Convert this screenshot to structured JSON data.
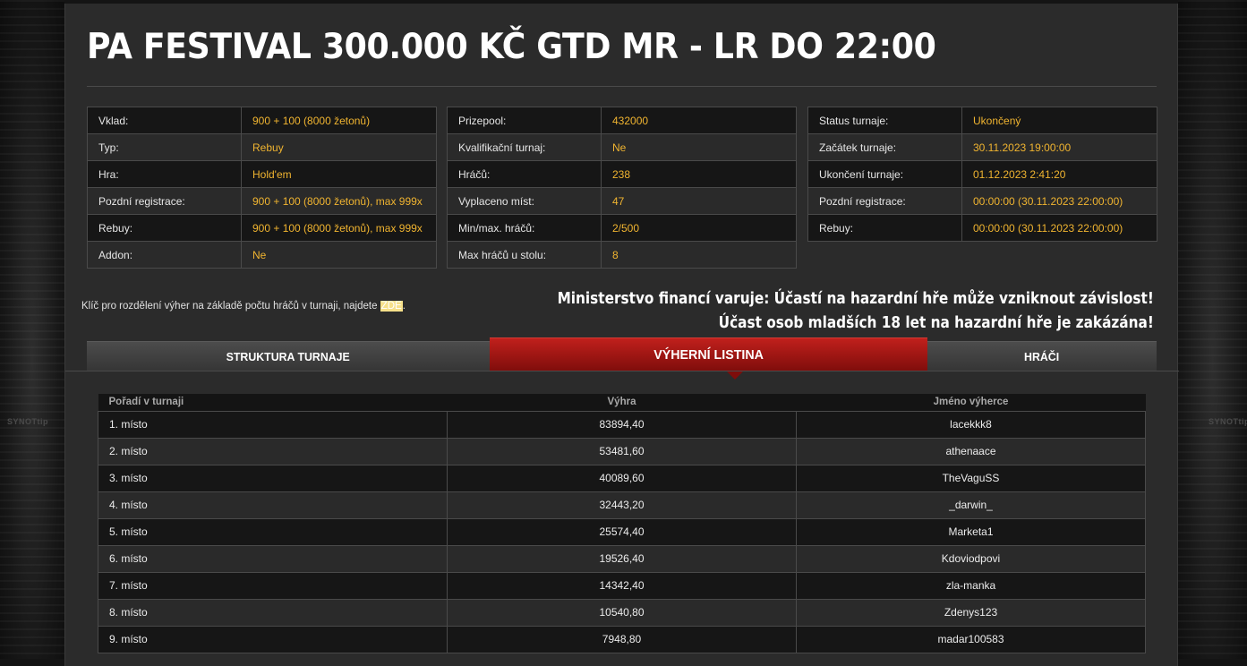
{
  "title": "PA FESTIVAL 300.000 KČ GTD MR - LR DO 22:00",
  "background_brand": "SYNOTtip",
  "info_left": [
    {
      "label": "Vklad:",
      "value": "900 + 100 (8000 žetonů)"
    },
    {
      "label": "Typ:",
      "value": "Rebuy"
    },
    {
      "label": "Hra:",
      "value": "Hold'em"
    },
    {
      "label": "Pozdní registrace:",
      "value": "900 + 100 (8000 žetonů), max 999x"
    },
    {
      "label": "Rebuy:",
      "value": "900 + 100 (8000 žetonů), max 999x"
    },
    {
      "label": "Addon:",
      "value": "Ne"
    }
  ],
  "info_middle": [
    {
      "label": "Prizepool:",
      "value": "432000"
    },
    {
      "label": "Kvalifikační turnaj:",
      "value": "Ne"
    },
    {
      "label": "Hráčů:",
      "value": "238"
    },
    {
      "label": "Vyplaceno míst:",
      "value": "47"
    },
    {
      "label": "Min/max. hráčů:",
      "value": "2/500"
    },
    {
      "label": "Max hráčů u stolu:",
      "value": "8"
    }
  ],
  "info_right": [
    {
      "label": "Status turnaje:",
      "value": "Ukončený"
    },
    {
      "label": "Začátek turnaje:",
      "value": "30.11.2023 19:00:00"
    },
    {
      "label": "Ukončení turnaje:",
      "value": "01.12.2023 2:41:20"
    },
    {
      "label": "Pozdní registrace:",
      "value": "00:00:00 (30.11.2023 22:00:00)"
    },
    {
      "label": "Rebuy:",
      "value": "00:00:00 (30.11.2023 22:00:00)"
    }
  ],
  "key_note": {
    "text": "Klíč pro rozdělení výher na základě počtu hráčů v turnaji, najdete ",
    "link": "ZDE",
    "suffix": "."
  },
  "warning": {
    "line1": "Ministerstvo financí varuje: Účastí na hazardní hře může vzniknout závislost!",
    "line2": "Účast osob mladších 18 let na hazardní hře je zakázána!"
  },
  "tabs": [
    {
      "label": "STRUKTURA TURNAJE",
      "active": false
    },
    {
      "label": "VÝHERNÍ LISTINA",
      "active": true
    },
    {
      "label": "HRÁČI",
      "active": false
    }
  ],
  "colors": {
    "accent_red": "#b5191a",
    "value_gold": "#f0b430",
    "panel": "#2b2b2b"
  },
  "results": {
    "headers": [
      "Pořadí v turnaji",
      "Výhra",
      "Jméno výherce"
    ],
    "rows": [
      [
        "1. místo",
        "83894,40",
        "lacekkk8"
      ],
      [
        "2. místo",
        "53481,60",
        "athenaace"
      ],
      [
        "3. místo",
        "40089,60",
        "TheVaguSS"
      ],
      [
        "4. místo",
        "32443,20",
        "_darwin_"
      ],
      [
        "5. místo",
        "25574,40",
        "Marketa1"
      ],
      [
        "6. místo",
        "19526,40",
        "Kdoviodpovi"
      ],
      [
        "7. místo",
        "14342,40",
        "zla-manka"
      ],
      [
        "8. místo",
        "10540,80",
        "Zdenys123"
      ],
      [
        "9. místo",
        "7948,80",
        "madar100583"
      ]
    ]
  }
}
